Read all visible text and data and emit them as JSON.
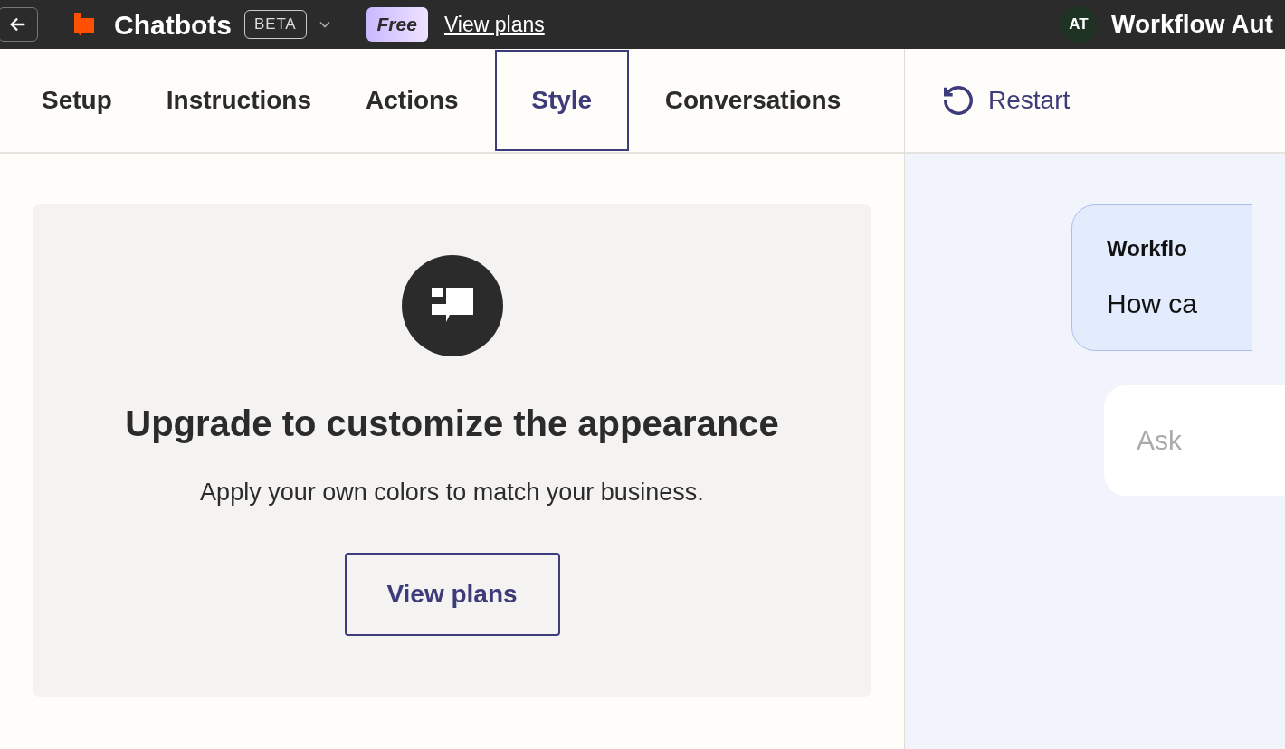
{
  "header": {
    "title": "Chatbots",
    "badge": "BETA",
    "plan": "Free",
    "plans_link": "View plans",
    "avatar": "AT",
    "workspace": "Workflow Aut"
  },
  "tabs": [
    {
      "label": "Setup",
      "selected": false
    },
    {
      "label": "Instructions",
      "selected": false
    },
    {
      "label": "Actions",
      "selected": false
    },
    {
      "label": "Style",
      "selected": true
    },
    {
      "label": "Conversations",
      "selected": false
    }
  ],
  "restart": "Restart",
  "upgrade": {
    "title": "Upgrade to customize the appearance",
    "text": "Apply your own colors to match your business.",
    "button": "View plans"
  },
  "preview": {
    "sender": "Workflo",
    "message": "How ca",
    "placeholder": "Ask"
  }
}
